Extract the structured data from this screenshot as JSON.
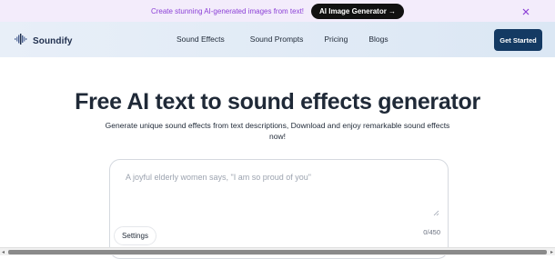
{
  "promo": {
    "text": "Create stunning AI-generated images from text!",
    "button_label": "AI Image Generator →",
    "close_icon": "close-icon"
  },
  "header": {
    "brand": "Soundify",
    "logo_icon": "sound-wave-icon",
    "nav": [
      {
        "label": "Sound Effects"
      },
      {
        "label": "Sound Prompts"
      },
      {
        "label": "Pricing"
      },
      {
        "label": "Blogs"
      }
    ],
    "cta_label": "Get Started"
  },
  "hero": {
    "title": "Free AI text to sound effects generator",
    "subtitle": "Generate unique sound effects from text descriptions, Download and enjoy remarkable sound effects now!"
  },
  "prompt": {
    "placeholder": "A joyful elderly women says, \"I am so proud of you\"",
    "settings_label": "Settings",
    "char_count": "0/450"
  },
  "colors": {
    "promo_bg": "#f3ecfb",
    "promo_text": "#8b3fd6",
    "cta_bg": "#143a63",
    "text": "#1f2937"
  }
}
